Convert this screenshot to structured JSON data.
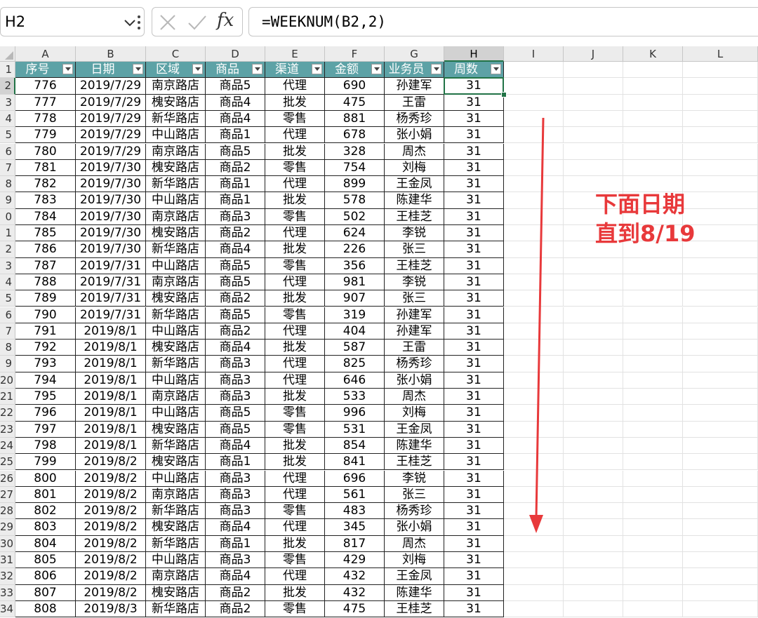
{
  "name_box": "H2",
  "formula": "=WEEKNUM(B2,2)",
  "fx_label": "fx",
  "selected_column": "H",
  "selected_row": "2",
  "column_letters": [
    "A",
    "B",
    "C",
    "D",
    "E",
    "F",
    "G",
    "H",
    "I",
    "J",
    "K",
    "L"
  ],
  "row_labels": [
    "1",
    "2",
    "3",
    "4",
    "5",
    "6",
    "7",
    "8",
    "9",
    "0",
    "1",
    "2",
    "3",
    "4",
    "5",
    "6",
    "7",
    "8",
    "9",
    "20",
    "21",
    "22",
    "23",
    "24",
    "25",
    "26",
    "27",
    "28",
    "29",
    "30",
    "31",
    "32",
    "33",
    "34"
  ],
  "table": {
    "headers": [
      "序号",
      "日期",
      "区域",
      "商品",
      "渠道",
      "金额",
      "业务员",
      "周数"
    ],
    "rows": [
      [
        "776",
        "2019/7/29",
        "南京路店",
        "商品5",
        "代理",
        "690",
        "孙建军",
        "31"
      ],
      [
        "777",
        "2019/7/29",
        "槐安路店",
        "商品4",
        "批发",
        "475",
        "王雷",
        "31"
      ],
      [
        "778",
        "2019/7/29",
        "新华路店",
        "商品4",
        "零售",
        "881",
        "杨秀珍",
        "31"
      ],
      [
        "779",
        "2019/7/29",
        "中山路店",
        "商品1",
        "代理",
        "678",
        "张小娟",
        "31"
      ],
      [
        "780",
        "2019/7/29",
        "南京路店",
        "商品5",
        "批发",
        "328",
        "周杰",
        "31"
      ],
      [
        "781",
        "2019/7/30",
        "槐安路店",
        "商品2",
        "零售",
        "754",
        "刘梅",
        "31"
      ],
      [
        "782",
        "2019/7/30",
        "新华路店",
        "商品1",
        "代理",
        "899",
        "王金凤",
        "31"
      ],
      [
        "783",
        "2019/7/30",
        "中山路店",
        "商品1",
        "批发",
        "578",
        "陈建华",
        "31"
      ],
      [
        "784",
        "2019/7/30",
        "南京路店",
        "商品3",
        "零售",
        "502",
        "王桂芝",
        "31"
      ],
      [
        "785",
        "2019/7/30",
        "槐安路店",
        "商品2",
        "代理",
        "624",
        "李锐",
        "31"
      ],
      [
        "786",
        "2019/7/30",
        "新华路店",
        "商品4",
        "批发",
        "226",
        "张三",
        "31"
      ],
      [
        "787",
        "2019/7/31",
        "中山路店",
        "商品5",
        "零售",
        "356",
        "王桂芝",
        "31"
      ],
      [
        "788",
        "2019/7/31",
        "南京路店",
        "商品5",
        "代理",
        "981",
        "李锐",
        "31"
      ],
      [
        "789",
        "2019/7/31",
        "槐安路店",
        "商品2",
        "批发",
        "907",
        "张三",
        "31"
      ],
      [
        "790",
        "2019/7/31",
        "新华路店",
        "商品5",
        "零售",
        "319",
        "孙建军",
        "31"
      ],
      [
        "791",
        "2019/8/1",
        "中山路店",
        "商品2",
        "代理",
        "404",
        "孙建军",
        "31"
      ],
      [
        "792",
        "2019/8/1",
        "槐安路店",
        "商品4",
        "批发",
        "587",
        "王雷",
        "31"
      ],
      [
        "793",
        "2019/8/1",
        "新华路店",
        "商品3",
        "代理",
        "825",
        "杨秀珍",
        "31"
      ],
      [
        "794",
        "2019/8/1",
        "中山路店",
        "商品3",
        "代理",
        "646",
        "张小娟",
        "31"
      ],
      [
        "795",
        "2019/8/1",
        "南京路店",
        "商品3",
        "批发",
        "533",
        "周杰",
        "31"
      ],
      [
        "796",
        "2019/8/1",
        "中山路店",
        "商品5",
        "零售",
        "996",
        "刘梅",
        "31"
      ],
      [
        "797",
        "2019/8/1",
        "槐安路店",
        "商品5",
        "零售",
        "531",
        "王金凤",
        "31"
      ],
      [
        "798",
        "2019/8/1",
        "新华路店",
        "商品4",
        "批发",
        "854",
        "陈建华",
        "31"
      ],
      [
        "799",
        "2019/8/2",
        "槐安路店",
        "商品1",
        "批发",
        "841",
        "王桂芝",
        "31"
      ],
      [
        "800",
        "2019/8/2",
        "中山路店",
        "商品3",
        "代理",
        "696",
        "李锐",
        "31"
      ],
      [
        "801",
        "2019/8/2",
        "南京路店",
        "商品3",
        "代理",
        "561",
        "张三",
        "31"
      ],
      [
        "802",
        "2019/8/2",
        "新华路店",
        "商品3",
        "零售",
        "483",
        "杨秀珍",
        "31"
      ],
      [
        "803",
        "2019/8/2",
        "槐安路店",
        "商品4",
        "代理",
        "345",
        "张小娟",
        "31"
      ],
      [
        "804",
        "2019/8/2",
        "新华路店",
        "商品1",
        "批发",
        "817",
        "周杰",
        "31"
      ],
      [
        "805",
        "2019/8/2",
        "中山路店",
        "商品3",
        "零售",
        "429",
        "刘梅",
        "31"
      ],
      [
        "806",
        "2019/8/2",
        "南京路店",
        "商品4",
        "代理",
        "432",
        "王金凤",
        "31"
      ],
      [
        "807",
        "2019/8/2",
        "槐安路店",
        "商品2",
        "批发",
        "432",
        "陈建华",
        "31"
      ],
      [
        "808",
        "2019/8/3",
        "新华路店",
        "商品2",
        "零售",
        "475",
        "王桂芝",
        "31"
      ]
    ]
  },
  "annotation": {
    "line1": "下面日期",
    "line2": "直到8/19",
    "color": "#e8393b"
  },
  "colors": {
    "header_fill": "#5da2a6",
    "selection": "#217346"
  }
}
